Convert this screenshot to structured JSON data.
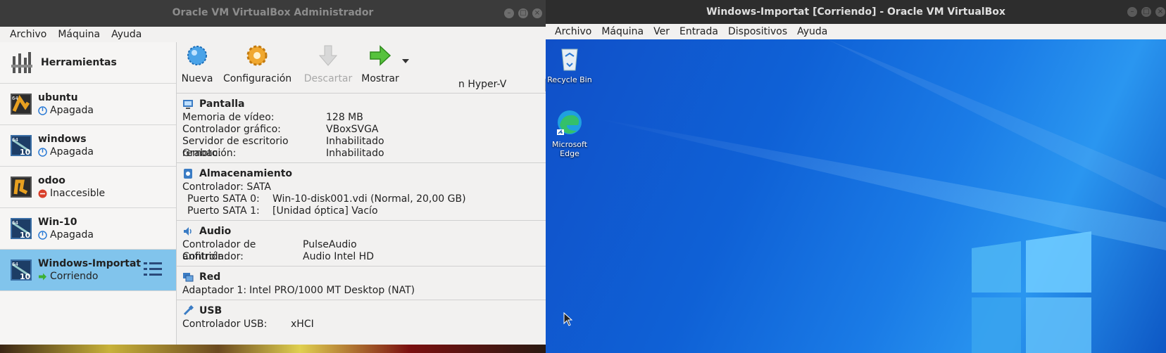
{
  "manager": {
    "title": "Oracle VM VirtualBox Administrador",
    "menu": [
      "Archivo",
      "Máquina",
      "Ayuda"
    ],
    "tools_label": "Herramientas",
    "vms": [
      {
        "name": "ubuntu",
        "state": "Apagada",
        "state_kind": "off",
        "os_badge": "64"
      },
      {
        "name": "windows",
        "state": "Apagada",
        "state_kind": "off",
        "os_badge": "64",
        "ver": "10"
      },
      {
        "name": "odoo",
        "state": "Inaccesible",
        "state_kind": "error",
        "os_badge": ""
      },
      {
        "name": "Win-10",
        "state": "Apagada",
        "state_kind": "off",
        "os_badge": "64",
        "ver": "10"
      },
      {
        "name": "Windows-Importat",
        "state": "Corriendo",
        "state_kind": "running",
        "os_badge": "64",
        "ver": "10",
        "selected": true
      }
    ],
    "toolbar": {
      "new": "Nueva",
      "settings": "Configuración",
      "discard": "Descartar",
      "show": "Mostrar",
      "overlay_text": "n Hyper-V"
    },
    "details": {
      "display": {
        "header": "Pantalla",
        "rows": [
          {
            "k": "Memoria de vídeo:",
            "v": "128 MB"
          },
          {
            "k": "Controlador gráfico:",
            "v": "VBoxSVGA"
          },
          {
            "k": "Servidor de escritorio remoto:",
            "v": "Inhabilitado"
          },
          {
            "k": "Grabación:",
            "v": "Inhabilitado"
          }
        ]
      },
      "storage": {
        "header": "Almacenamiento",
        "controller": "Controlador: SATA",
        "rows": [
          {
            "k": "Puerto SATA 0:",
            "v": "Win-10-disk001.vdi (Normal, 20,00 GB)"
          },
          {
            "k": "Puerto SATA 1:",
            "v": "[Unidad óptica] Vacío"
          }
        ]
      },
      "audio": {
        "header": "Audio",
        "rows": [
          {
            "k": "Controlador de anfitrión:",
            "v": "PulseAudio"
          },
          {
            "k": "Controlador:",
            "v": "Audio Intel HD"
          }
        ]
      },
      "network": {
        "header": "Red",
        "rows": [
          {
            "k": "Adaptador 1:",
            "v": "Intel PRO/1000 MT Desktop (NAT)"
          }
        ]
      },
      "usb": {
        "header": "USB",
        "rows": [
          {
            "k": "Controlador USB:",
            "v": "xHCI"
          }
        ]
      }
    }
  },
  "vm_window": {
    "title": "Windows-Importat [Corriendo] - Oracle VM VirtualBox",
    "menu": [
      "Archivo",
      "Máquina",
      "Ver",
      "Entrada",
      "Dispositivos",
      "Ayuda"
    ],
    "desktop_icons": [
      {
        "label": "Recycle Bin",
        "icon": "recycle-bin-icon"
      },
      {
        "label": "Microsoft Edge",
        "icon": "edge-icon"
      }
    ]
  }
}
